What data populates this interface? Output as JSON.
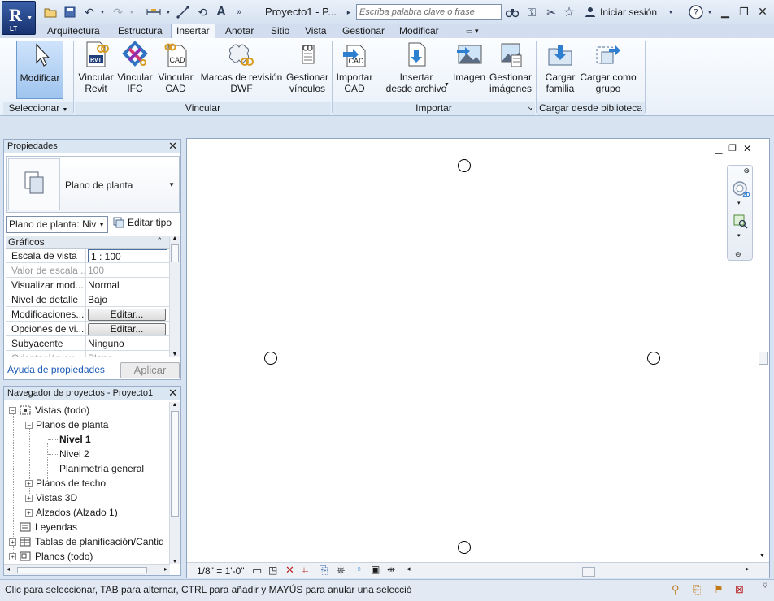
{
  "app": {
    "logo_letter": "R",
    "logo_sub": "LT"
  },
  "titlebar": {
    "doc_title": "Proyecto1 - P...",
    "search_placeholder": "Escriba palabra clave o frase",
    "signin": "Iniciar sesión"
  },
  "tabs": [
    "Arquitectura",
    "Estructura",
    "Insertar",
    "Anotar",
    "Sitio",
    "Vista",
    "Gestionar",
    "Modificar"
  ],
  "active_tab": "Insertar",
  "ribbon": {
    "buttons": [
      {
        "label1": "Modificar",
        "label2": "",
        "icon": "cursor-icon"
      },
      {
        "label1": "Vincular",
        "label2": "Revit",
        "icon": "link-revit-icon"
      },
      {
        "label1": "Vincular",
        "label2": "IFC",
        "icon": "link-ifc-icon"
      },
      {
        "label1": "Vincular",
        "label2": "CAD",
        "icon": "link-cad-icon"
      },
      {
        "label1": "Marcas de revisión",
        "label2": "DWF",
        "icon": "dwf-markup-icon"
      },
      {
        "label1": "Gestionar",
        "label2": "vínculos",
        "icon": "manage-links-icon"
      },
      {
        "label1": "Importar",
        "label2": "CAD",
        "icon": "import-cad-icon"
      },
      {
        "label1": "Insertar",
        "label2": "desde archivo",
        "icon": "insert-file-icon"
      },
      {
        "label1": "Imagen",
        "label2": "",
        "icon": "image-icon"
      },
      {
        "label1": "Gestionar",
        "label2": "imágenes",
        "icon": "manage-images-icon"
      },
      {
        "label1": "Cargar",
        "label2": "familia",
        "icon": "load-family-icon"
      },
      {
        "label1": "Cargar como",
        "label2": "grupo",
        "icon": "load-group-icon"
      }
    ],
    "panels": {
      "select": "Seleccionar",
      "link": "Vincular",
      "import": "Importar",
      "library": "Cargar desde biblioteca"
    },
    "cad_text": "CAD",
    "rvt_text": "RVT"
  },
  "properties": {
    "title": "Propiedades",
    "type_name": "Plano de planta",
    "instance_selector": "Plano de planta: Niv",
    "edit_type": "Editar tipo",
    "group": "Gráficos",
    "rows": [
      {
        "key": "Escala de vista",
        "value": "1 : 100"
      },
      {
        "key": "Valor de escala ...",
        "value": "100"
      },
      {
        "key": "Visualizar mod...",
        "value": "Normal"
      },
      {
        "key": "Nivel de detalle",
        "value": "Bajo"
      },
      {
        "key": "Modificaciones...",
        "value": "Editar..."
      },
      {
        "key": "Opciones de vi...",
        "value": "Editar..."
      },
      {
        "key": "Subyacente",
        "value": "Ninguno"
      },
      {
        "key": "Orientación su...",
        "value": "Plano"
      }
    ],
    "help_link": "Ayuda de propiedades",
    "apply": "Aplicar"
  },
  "browser": {
    "title": "Navegador de proyectos - Proyecto1",
    "nodes": [
      {
        "label": "Vistas (todo)",
        "exp": "−"
      },
      {
        "label": "Planos de planta",
        "exp": "−"
      },
      {
        "label": "Nivel 1",
        "exp": ""
      },
      {
        "label": "Nivel 2",
        "exp": ""
      },
      {
        "label": "Planimetría general",
        "exp": ""
      },
      {
        "label": "Planos de techo",
        "exp": "+"
      },
      {
        "label": "Vistas 3D",
        "exp": "+"
      },
      {
        "label": "Alzados (Alzado 1)",
        "exp": "+"
      },
      {
        "label": "Leyendas",
        "exp": ""
      },
      {
        "label": "Tablas de planificación/Cantid",
        "exp": "+"
      },
      {
        "label": "Planos (todo)",
        "exp": "+"
      }
    ]
  },
  "viewcontrol": {
    "scale": "1/8\" = 1'-0\""
  },
  "status": {
    "text": "Clic para seleccionar, TAB para alternar, CTRL para añadir y MAYÚS para anular una selecció"
  }
}
